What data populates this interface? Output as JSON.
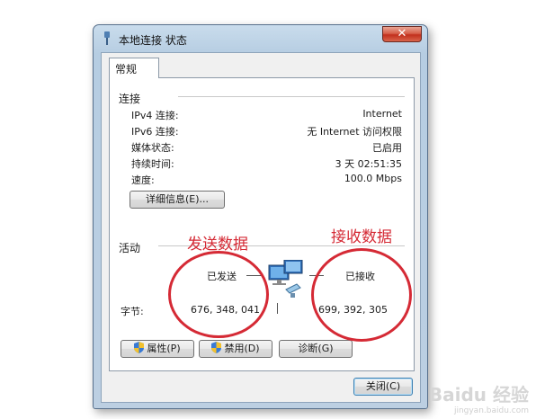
{
  "window": {
    "title": "本地连接 状态",
    "close_glyph": "✕"
  },
  "tab": {
    "label": "常规"
  },
  "connection": {
    "header": "连接",
    "rows": [
      {
        "label": "IPv4 连接:",
        "value": "Internet"
      },
      {
        "label": "IPv6 连接:",
        "value": "无 Internet 访问权限"
      },
      {
        "label": "媒体状态:",
        "value": "已启用"
      },
      {
        "label": "持续时间:",
        "value": "3 天 02:51:35"
      },
      {
        "label": "速度:",
        "value": "100.0 Mbps"
      }
    ],
    "details_button": "详细信息(E)..."
  },
  "activity": {
    "header": "活动",
    "sent_label": "已发送",
    "received_label": "已接收",
    "bytes_label": "字节:",
    "sent_bytes": "676, 348, 041",
    "received_bytes": "699, 392, 305"
  },
  "annotations": {
    "sent": "发送数据",
    "received": "接收数据",
    "color": "#d52a35"
  },
  "buttons": {
    "properties": "属性(P)",
    "disable": "禁用(D)",
    "diagnose": "诊断(G)",
    "close": "关闭(C)"
  },
  "watermark": {
    "text": "Baidu 经验",
    "sub": "jingyan.baidu.com"
  }
}
